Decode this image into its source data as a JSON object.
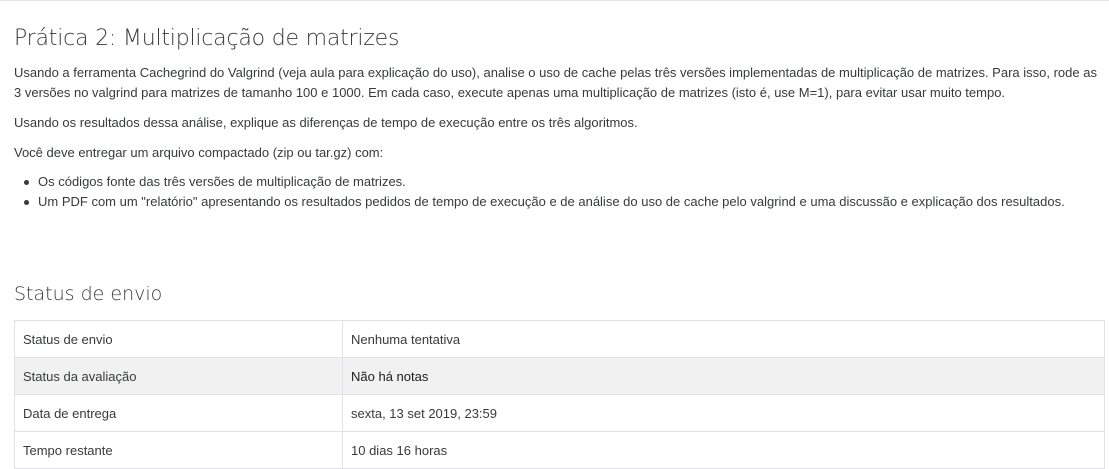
{
  "assignment": {
    "title": "Prática 2: Multiplicação de matrizes",
    "paragraphs": [
      "Usando a ferramenta Cachegrind do Valgrind (veja aula para explicação do uso), analise o uso de cache pelas três versões implementadas de multiplicação de matrizes. Para isso, rode as 3 versões no valgrind para matrizes de tamanho 100 e 1000. Em cada caso, execute apenas uma multiplicação de matrizes (isto é, use M=1), para evitar usar muito tempo.",
      "Usando os resultados dessa análise, explique as diferenças de tempo de execução entre os três algoritmos.",
      "Você deve entregar um arquivo compactado (zip ou tar.gz) com:"
    ],
    "deliverables": [
      "Os códigos fonte das três versões de multiplicação de matrizes.",
      "Um PDF com um \"relatório\" apresentando os resultados pedidos de tempo de execução e de análise do uso de cache pelo valgrind e uma discussão e explicação dos resultados."
    ]
  },
  "submission": {
    "heading": "Status de envio",
    "rows": [
      {
        "label": "Status de envio",
        "value": "Nenhuma tentativa"
      },
      {
        "label": "Status da avaliação",
        "value": "Não há notas"
      },
      {
        "label": "Data de entrega",
        "value": "sexta, 13 set 2019, 23:59"
      },
      {
        "label": "Tempo restante",
        "value": "10 dias 16 horas"
      }
    ]
  }
}
